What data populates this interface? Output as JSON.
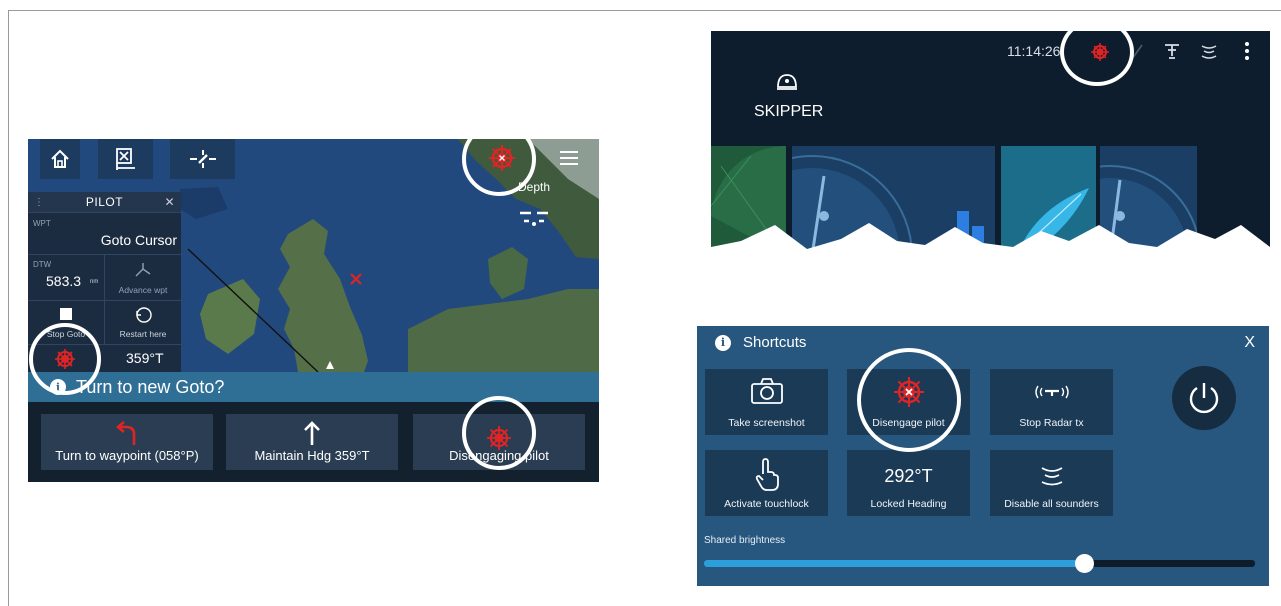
{
  "chartplotter": {
    "menu_icon": "hamburger-icon",
    "depth_label": "Depth",
    "pilot_panel": {
      "title": "PILOT",
      "wpt_label": "WPT",
      "wpt_value": "Goto Cursor",
      "dtw_label": "DTW",
      "dtw_value": "583.3",
      "dtw_unit": "nm",
      "advance_label": "Advance wpt",
      "stop_label": "Stop Goto",
      "restart_label": "Restart here",
      "heading_value": "359°T"
    },
    "prompt": "Turn to new Goto?",
    "actions": [
      {
        "label": "Turn to waypoint (058°P)"
      },
      {
        "label": "Maintain Hdg 359°T"
      },
      {
        "label": "Disengaging pilot"
      }
    ]
  },
  "home_screen": {
    "time": "11:14:26",
    "profile_name": "SKIPPER"
  },
  "shortcuts": {
    "title": "Shortcuts",
    "close": "X",
    "tiles": [
      {
        "label": "Take screenshot",
        "icon": "camera-icon"
      },
      {
        "label": "Disengage pilot",
        "icon": "pilot-helm-icon"
      },
      {
        "label": "Stop Radar tx",
        "icon": "radar-transmit-icon"
      },
      {
        "label": "Activate touchlock",
        "icon": "touch-hand-icon"
      },
      {
        "label": "Locked Heading",
        "value": "292°T"
      },
      {
        "label": "Disable all sounders",
        "icon": "sounder-icon"
      }
    ],
    "brightness_label": "Shared brightness",
    "brightness_level": 0.69
  },
  "colors": {
    "pilot_alert": "#e02424",
    "slider_fill": "#2d9fdb",
    "panel_blue": "#27577f"
  }
}
